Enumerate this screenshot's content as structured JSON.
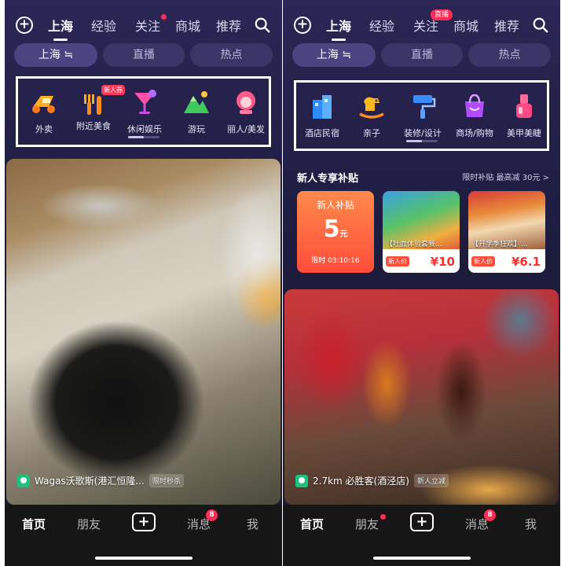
{
  "screens": [
    {
      "topnav": {
        "tabs": [
          {
            "label": "上海",
            "active": true
          },
          {
            "label": "经验",
            "active": false
          },
          {
            "label": "关注",
            "active": false,
            "dot": true
          },
          {
            "label": "商城",
            "active": false
          },
          {
            "label": "推荐",
            "active": false
          }
        ]
      },
      "subtabs": [
        {
          "label": "上海 ≒",
          "active": true
        },
        {
          "label": "直播",
          "active": false
        },
        {
          "label": "热点",
          "active": false
        }
      ],
      "categories": [
        {
          "label": "外卖",
          "icon": "scooter-icon"
        },
        {
          "label": "附近美食",
          "icon": "fork-icon",
          "badge": "新人券"
        },
        {
          "label": "休闲娱乐",
          "icon": "cocktail-icon"
        },
        {
          "label": "游玩",
          "icon": "mountain-icon"
        },
        {
          "label": "丽人/美发",
          "icon": "beauty-icon"
        }
      ],
      "feed": {
        "location": "Wagas沃歌斯(港汇恒隆...",
        "tag": "限时秒杀"
      },
      "bottom": {
        "items": [
          "首页",
          "朋友",
          "消息",
          "我"
        ],
        "message_count": "8"
      }
    },
    {
      "topnav": {
        "tabs": [
          {
            "label": "上海",
            "active": true
          },
          {
            "label": "经验",
            "active": false
          },
          {
            "label": "关注",
            "active": false,
            "badge": "直播"
          },
          {
            "label": "商城",
            "active": false
          },
          {
            "label": "推荐",
            "active": false
          }
        ]
      },
      "subtabs": [
        {
          "label": "上海 ≒",
          "active": true
        },
        {
          "label": "直播",
          "active": false
        },
        {
          "label": "热点",
          "active": false
        }
      ],
      "categories": [
        {
          "label": "酒店民宿",
          "icon": "hotel-icon"
        },
        {
          "label": "亲子",
          "icon": "rocking-horse-icon"
        },
        {
          "label": "装修/设计",
          "icon": "paint-roller-icon"
        },
        {
          "label": "商场/购物",
          "icon": "shopping-bag-icon"
        },
        {
          "label": "美甲美睫",
          "icon": "nail-polish-icon"
        }
      ],
      "subsidy": {
        "title": "新人专享补贴",
        "right": "限时补贴 最高减 30元 >",
        "coupon": {
          "title": "新人补贴",
          "amount": "5",
          "unit": "元",
          "timer": "限时 03:10:16"
        },
        "products": [
          {
            "name": "【吐血体验套餐...",
            "tag": "新人价",
            "price": "¥10"
          },
          {
            "name": "【开学季狂欢】...",
            "tag": "新人价",
            "price": "¥6.1"
          }
        ]
      },
      "feed": {
        "location": "2.7km  必胜客(酒泾店)",
        "tag": "新人立减"
      },
      "bottom": {
        "items": [
          "首页",
          "朋友",
          "消息",
          "我"
        ],
        "message_count": "8",
        "friend_dot": true
      }
    }
  ],
  "colors": {
    "accent": "#ff2d55",
    "bg_top": "#2b2655",
    "bottom_bar": "#161616"
  }
}
